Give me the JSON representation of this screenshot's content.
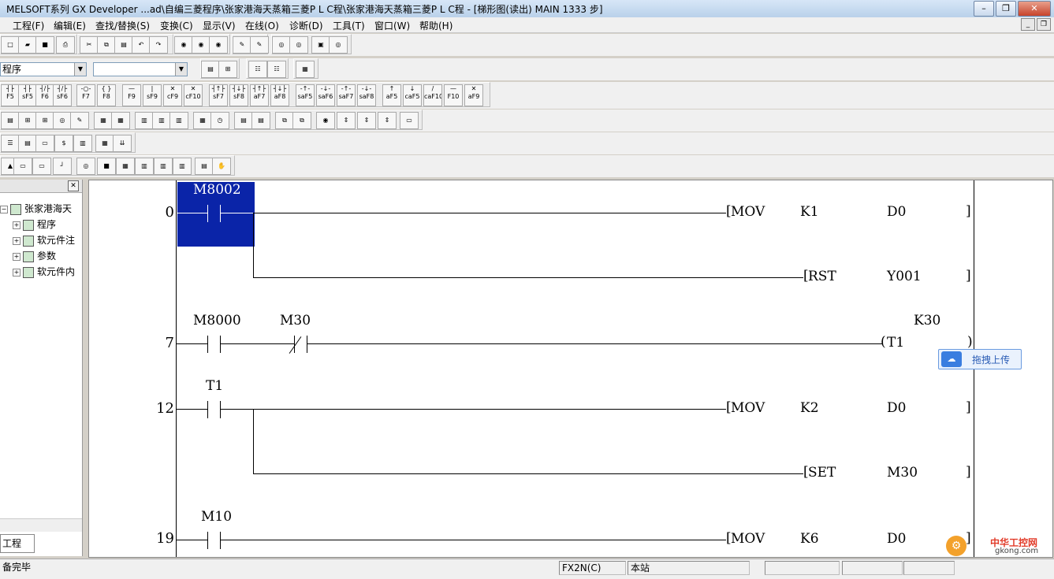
{
  "window": {
    "title": "MELSOFT系列 GX Developer ...ad\\自编三菱程序\\张家港海天蒸箱三菱P L C程\\张家港海天蒸箱三菱P L C程 - [梯形图(读出)    MAIN    1333 步]"
  },
  "menu": [
    "工程(F)",
    "编辑(E)",
    "查找/替换(S)",
    "变换(C)",
    "显示(V)",
    "在线(O)",
    "诊断(D)",
    "工具(T)",
    "窗口(W)",
    "帮助(H)"
  ],
  "toolbar": {
    "program_combo": "程序",
    "device_combo": "",
    "fkeys": [
      "F5",
      "sF5",
      "F6",
      "sF6",
      "F7",
      "F8",
      "F9",
      "sF9",
      "cF9",
      "cF10",
      "sF7",
      "sF8",
      "aF7",
      "aF8",
      "saF5",
      "saF6",
      "saF7",
      "saF8",
      "aF5",
      "caF5",
      "caF10",
      "F10",
      "aF9"
    ]
  },
  "project_tree": {
    "root": "张家港海天",
    "items": [
      "程序",
      "软元件注",
      "参数",
      "软元件内"
    ],
    "tab": "工程"
  },
  "ladder": {
    "rungs": [
      {
        "step": "0",
        "contact": "M8002",
        "instr1": "MOV",
        "op1a": "K1",
        "op1b": "D0",
        "instr2": "RST",
        "op2": "Y001"
      },
      {
        "step": "7",
        "contact1": "M8000",
        "contact2": "M30",
        "coil": "T1",
        "coil_k": "K30"
      },
      {
        "step": "12",
        "contact": "T1",
        "instr1": "MOV",
        "op1a": "K2",
        "op1b": "D0",
        "instr2": "SET",
        "op2": "M30"
      },
      {
        "step": "19",
        "contact": "M10",
        "instr1": "MOV",
        "op1a": "K6",
        "op1b": "D0"
      }
    ]
  },
  "overlay": {
    "upload_label": "拖拽上传",
    "watermark_cn": "中华工控网",
    "watermark_url": "gkong.com"
  },
  "status": {
    "left": "备完毕",
    "plc": "FX2N(C)",
    "station": "本站"
  },
  "colors": {
    "cursor": "#0a24a8",
    "titlebar": "#c6d9ee"
  }
}
